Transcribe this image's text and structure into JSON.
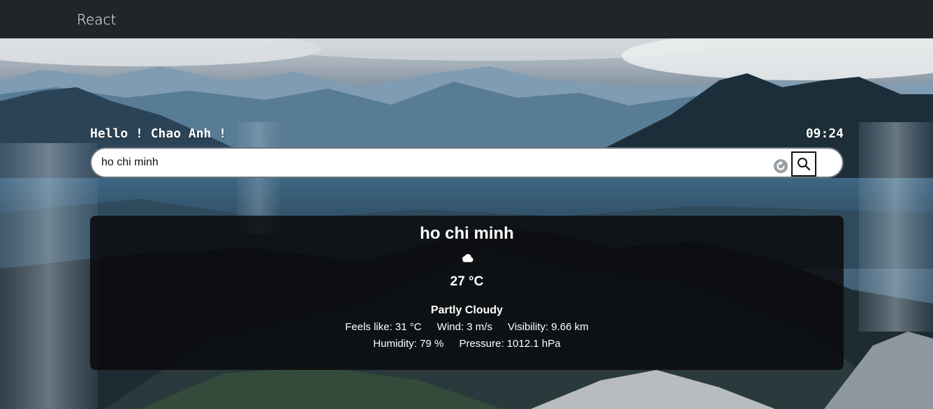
{
  "navbar": {
    "brand": "React"
  },
  "header": {
    "greeting": "Hello ! Chao Anh !",
    "time": "09:24"
  },
  "search": {
    "value": "ho chi minh",
    "placeholder": ""
  },
  "weather": {
    "city": "ho chi minh",
    "icon": "cloud-icon",
    "temperature": "27 °C",
    "condition": "Partly Cloudy",
    "feels_like": "Feels like: 31 °C",
    "wind": "Wind: 3 m/s",
    "visibility": "Visibility: 9.66 km",
    "humidity": "Humidity: 79 %",
    "pressure": "Pressure: 1012.1 hPa"
  },
  "colors": {
    "navbar": "#212529",
    "card": "#08080a",
    "accent": "#ffffff"
  }
}
